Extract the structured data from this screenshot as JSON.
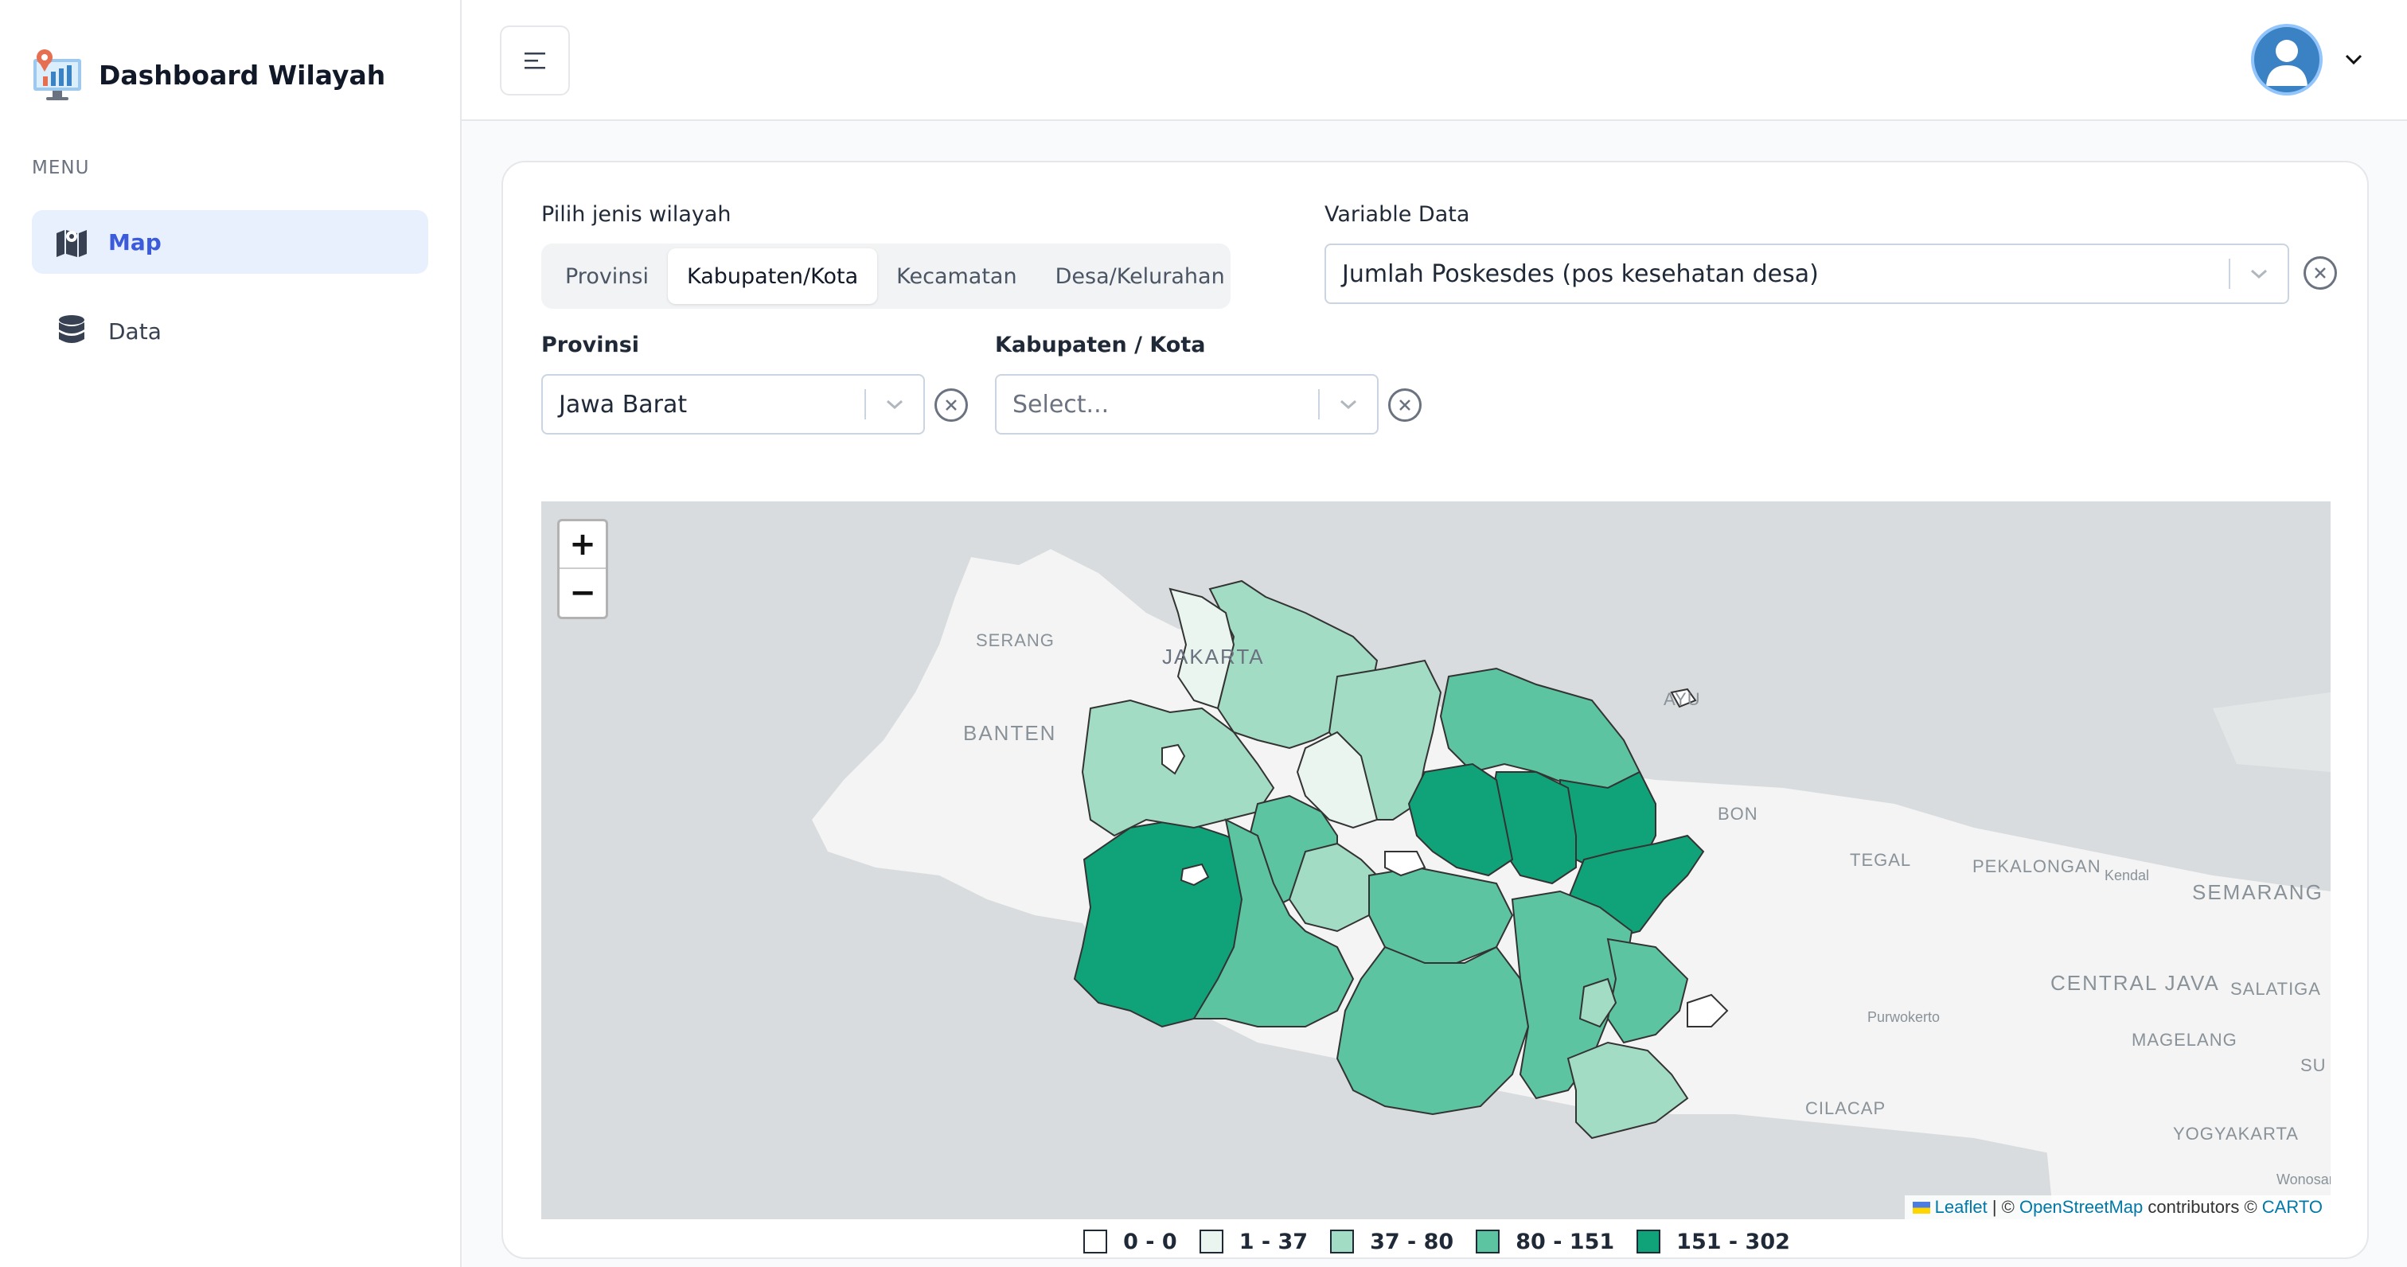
{
  "app": {
    "title": "Dashboard Wilayah"
  },
  "sidebar": {
    "menu_label": "MENU",
    "items": [
      {
        "label": "Map",
        "icon": "map-icon",
        "active": true
      },
      {
        "label": "Data",
        "icon": "database-icon",
        "active": false
      }
    ]
  },
  "filters": {
    "region_type_label": "Pilih jenis wilayah",
    "region_types": [
      "Provinsi",
      "Kabupaten/Kota",
      "Kecamatan",
      "Desa/Kelurahan"
    ],
    "region_type_selected": "Kabupaten/Kota",
    "variable_label": "Variable Data",
    "variable_value": "Jumlah Poskesdes (pos kesehatan desa)",
    "province_label": "Provinsi",
    "province_value": "Jawa Barat",
    "regency_label": "Kabupaten / Kota",
    "regency_placeholder": "Select..."
  },
  "map": {
    "zoom_in": "+",
    "zoom_out": "−",
    "places": [
      "SERANG",
      "JAKARTA",
      "BANTEN",
      "TEGAL",
      "PEKALONGAN",
      "Kendal",
      "SEMARANG",
      "CENTRAL JAVA",
      "SALATIGA",
      "Purwokerto",
      "MAGELANG",
      "CILACAP",
      "YOGYAKARTA",
      "Wonosari",
      "AYU",
      "BON",
      "SU"
    ],
    "attribution": {
      "leaflet": "Leaflet",
      "sep": " | © ",
      "osm": "OpenStreetMap",
      "contrib": " contributors © ",
      "carto": "CARTO"
    }
  },
  "legend": [
    {
      "label": "0 - 0",
      "color": "#ffffff"
    },
    {
      "label": "1 - 37",
      "color": "#e9f5ee"
    },
    {
      "label": "37 - 80",
      "color": "#a3dcc4"
    },
    {
      "label": "80 - 151",
      "color": "#5cc4a0"
    },
    {
      "label": "151 - 302",
      "color": "#10a37a"
    }
  ],
  "colors": {
    "accent": "#3b5bdb",
    "active_bg": "#e8f0fd"
  }
}
